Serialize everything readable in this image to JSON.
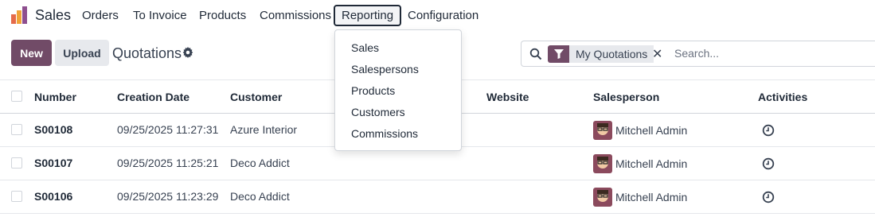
{
  "app": {
    "name": "Sales"
  },
  "nav": [
    {
      "label": "Orders"
    },
    {
      "label": "To Invoice"
    },
    {
      "label": "Products"
    },
    {
      "label": "Commissions"
    },
    {
      "label": "Reporting"
    },
    {
      "label": "Configuration"
    }
  ],
  "control": {
    "new_label": "New",
    "upload_label": "Upload",
    "title": "Quotations"
  },
  "search": {
    "facet_label": "My Quotations",
    "placeholder": "Search..."
  },
  "table": {
    "headers": [
      "Number",
      "Creation Date",
      "Customer",
      "Website",
      "Salesperson",
      "Activities"
    ],
    "rows": [
      {
        "number": "S00108",
        "date": "09/25/2025 11:27:31",
        "customer": "Azure Interior",
        "salesperson": "Mitchell Admin"
      },
      {
        "number": "S00107",
        "date": "09/25/2025 11:25:21",
        "customer": "Deco Addict",
        "salesperson": "Mitchell Admin"
      },
      {
        "number": "S00106",
        "date": "09/25/2025 11:23:29",
        "customer": "Deco Addict",
        "salesperson": "Mitchell Admin"
      }
    ]
  },
  "reporting_menu": [
    "Sales",
    "Salespersons",
    "Products",
    "Customers",
    "Commissions"
  ],
  "colors": {
    "brand": "#714b67",
    "secondary_button": "#e7e9ed"
  }
}
